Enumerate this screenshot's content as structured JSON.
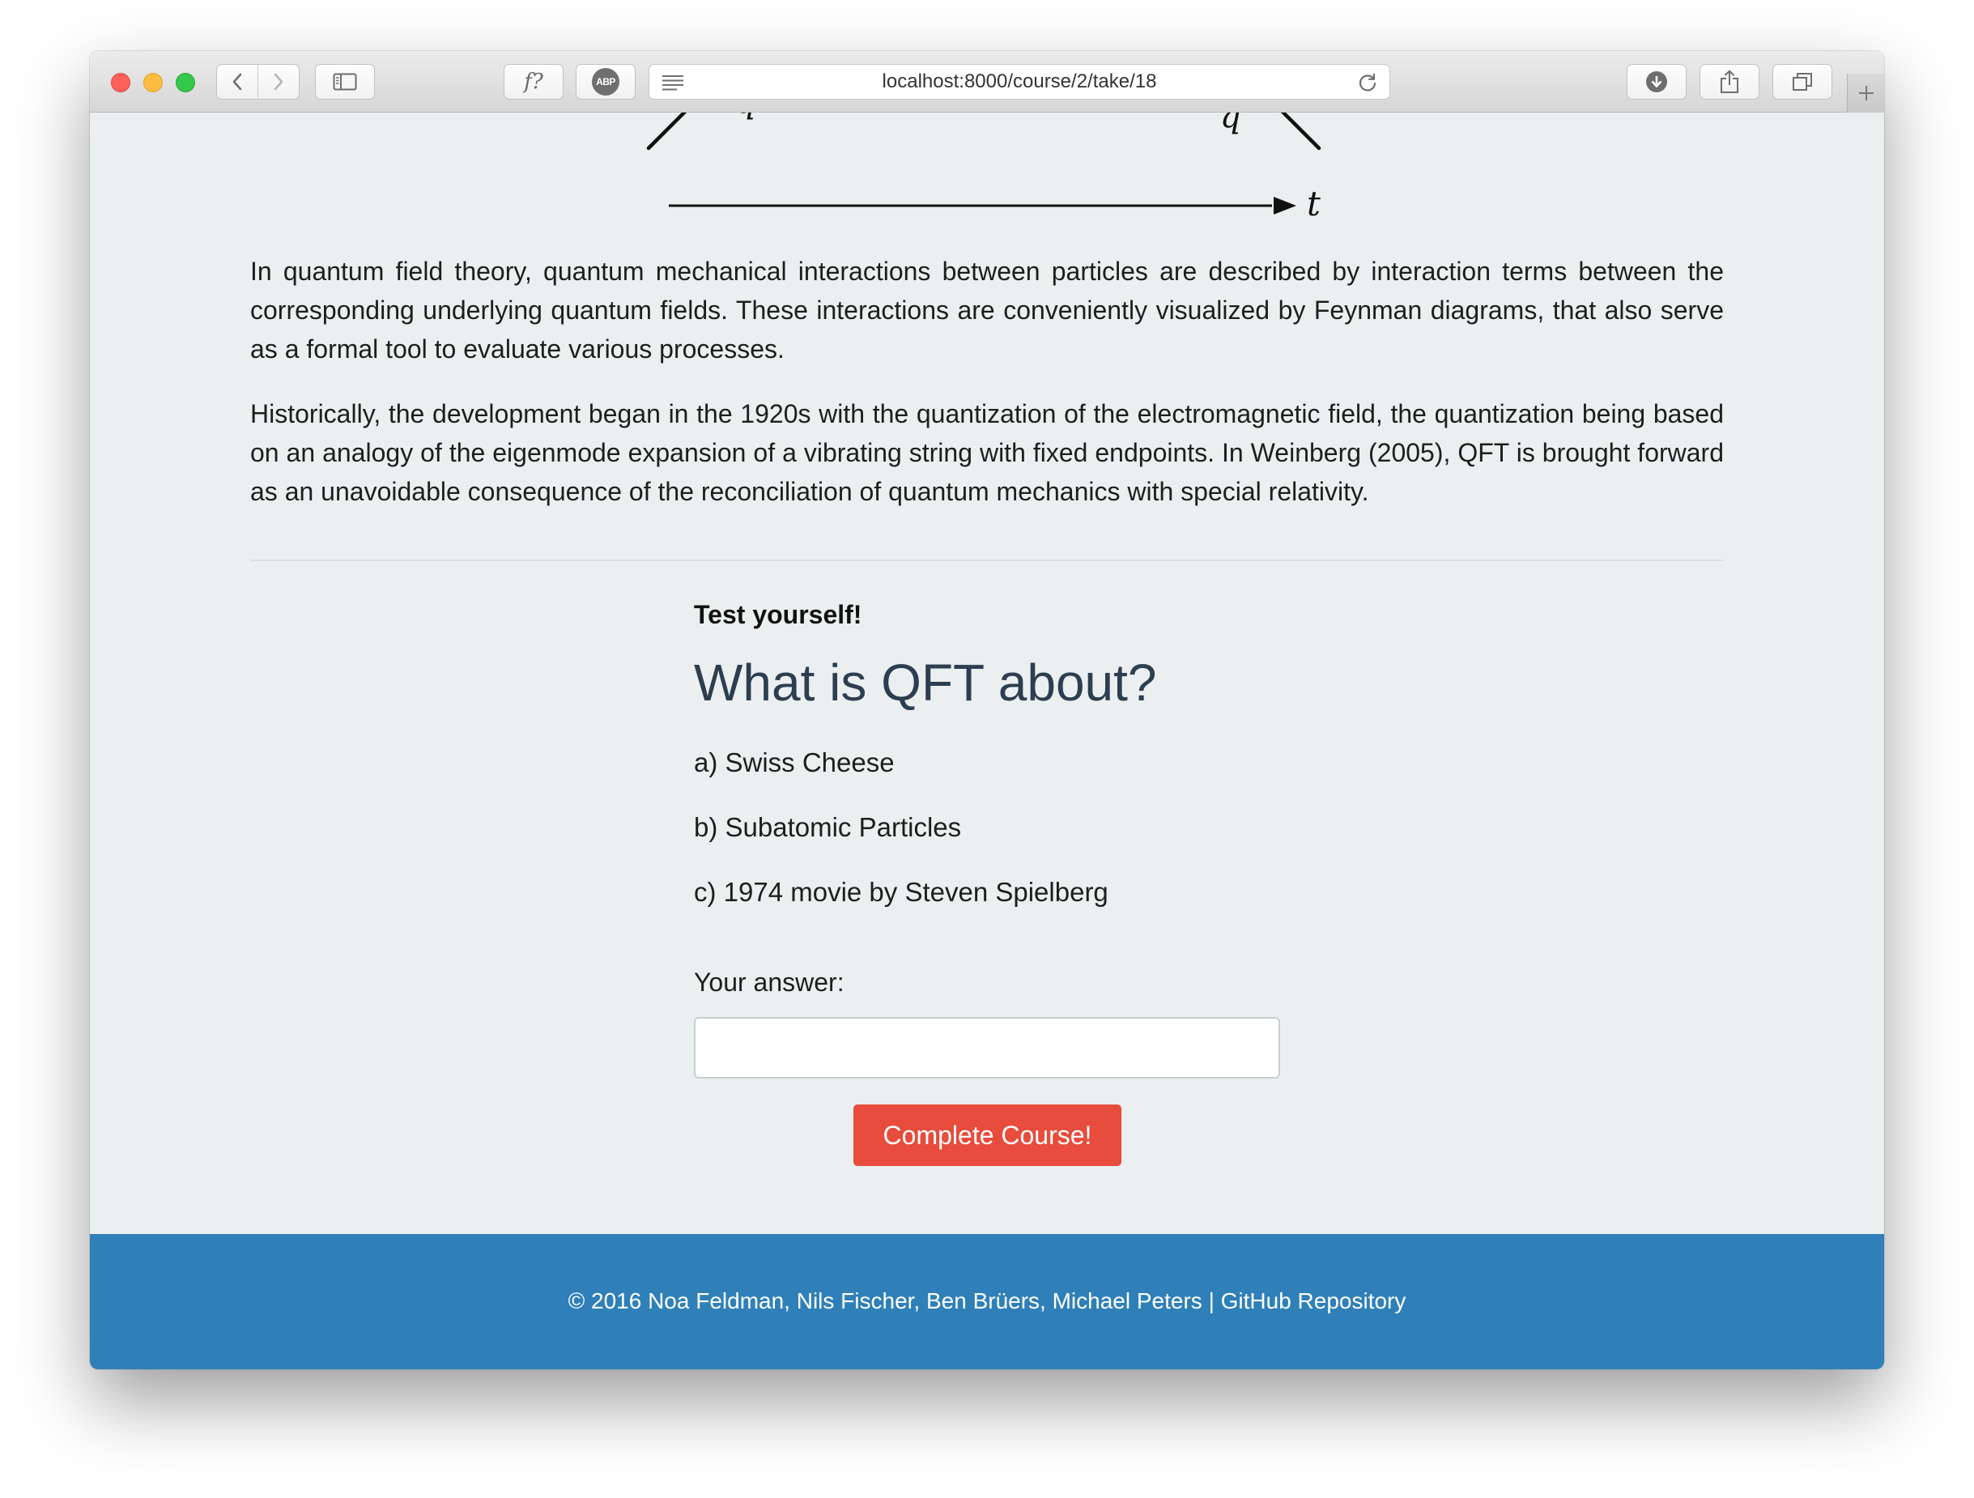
{
  "browser": {
    "url": "localhost:8000/course/2/take/18",
    "toolbar_icons": {
      "back": "chevron-left-icon",
      "forward": "chevron-right-icon",
      "sidebar": "sidebar-icon",
      "formula": "formula-icon",
      "formula_glyph": "f?",
      "adblock": "adblock-icon",
      "adblock_glyph": "ABP",
      "reader": "reader-icon",
      "reload": "reload-icon",
      "download": "download-icon",
      "share": "share-icon",
      "tabs": "tabs-icon",
      "new_tab": "plus-icon"
    }
  },
  "diagram": {
    "axis_label": "t",
    "left_label": "q",
    "right_label": "q"
  },
  "article": {
    "paragraphs": [
      "In quantum field theory, quantum mechanical interactions between particles are described by interaction terms between the corresponding underlying quantum fields. These interactions are conveniently visualized by Feynman diagrams, that also serve as a formal tool to evaluate various processes.",
      "Historically, the development began in the 1920s with the quantization of the electromagnetic field, the quantization being based on an analogy of the eigenmode expansion of a vibrating string with fixed endpoints. In Weinberg (2005), QFT is brought forward as an unavoidable consequence of the reconciliation of quantum mechanics with special relativity."
    ]
  },
  "quiz": {
    "kicker": "Test yourself!",
    "question": "What is QFT about?",
    "options": [
      "a) Swiss Cheese",
      "b) Subatomic Particles",
      "c) 1974 movie by Steven Spielberg"
    ],
    "answer_label": "Your answer:",
    "answer_value": "",
    "submit_label": "Complete Course!"
  },
  "footer": {
    "copyright": "© 2016 Noa Feldman, Nils Fischer, Ben Brüers, Michael Peters | ",
    "repo_link": "GitHub Repository"
  },
  "colors": {
    "page_background": "#eceff0",
    "question_text": "#2c3e50",
    "button": "#e74c3c",
    "footer": "#2f80b8"
  }
}
